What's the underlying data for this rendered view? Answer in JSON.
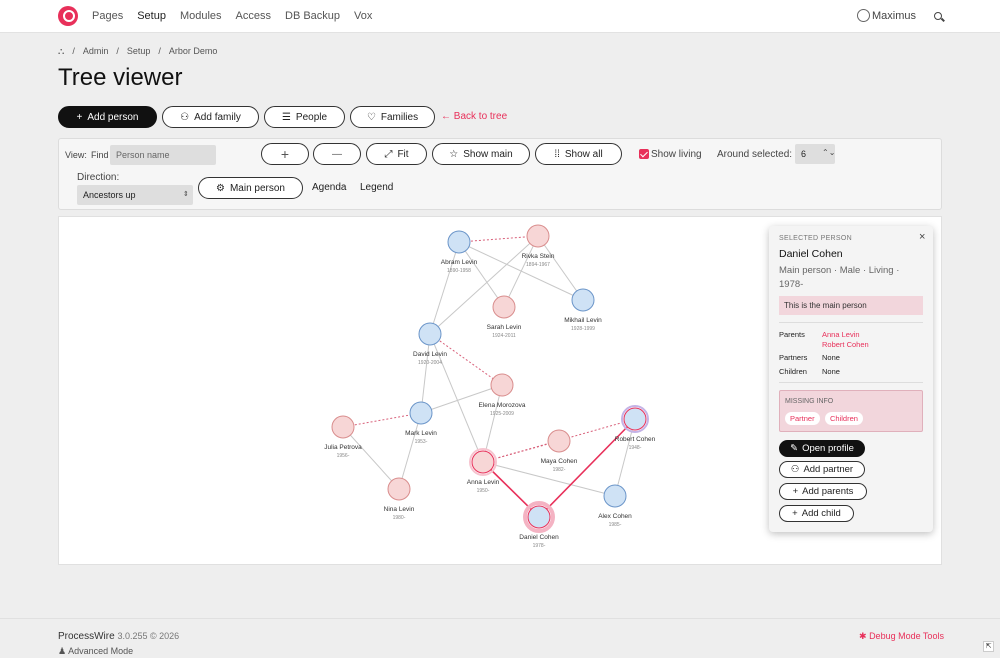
{
  "nav": {
    "items": [
      "Pages",
      "Setup",
      "Modules",
      "Access",
      "DB Backup",
      "Vox"
    ],
    "user": "Maximus"
  },
  "breadcrumb": [
    "Admin",
    "Setup",
    "Arbor Demo"
  ],
  "page": {
    "title": "Tree viewer"
  },
  "actions": {
    "add_person": "Add person",
    "add_family": "Add family",
    "people": "People",
    "families": "Families",
    "back": "← Back to tree"
  },
  "toolbar": {
    "view_label": "View:",
    "find_label": "Find",
    "find_placeholder": "Person name",
    "zoom_in": "+",
    "zoom_out": "—",
    "fit": "Fit",
    "show_main": "Show main",
    "show_all": "Show all",
    "show_living": "Show living",
    "around_label": "Around selected:",
    "around_value": "6",
    "direction_label": "Direction:",
    "direction_value": "Ancestors up",
    "main_person": "Main person",
    "agenda": "Agenda",
    "legend": "Legend"
  },
  "colors": {
    "accent": "#e8305a",
    "male": "#cfe2f5",
    "female": "#f7d6d6",
    "male_stroke": "#6b95c9",
    "female_stroke": "#d98d8d"
  },
  "tree": {
    "people": [
      {
        "id": "abram",
        "name": "Abram Levin",
        "dates": "1890-1958",
        "sex": "m"
      },
      {
        "id": "rivka",
        "name": "Rivka Stein",
        "dates": "1894-1967",
        "sex": "f"
      },
      {
        "id": "sarah",
        "name": "Sarah Levin",
        "dates": "1924-2011",
        "sex": "f"
      },
      {
        "id": "mikhail",
        "name": "Mikhail Levin",
        "dates": "1928-1999",
        "sex": "m"
      },
      {
        "id": "david",
        "name": "David Levin",
        "dates": "1920-2004",
        "sex": "m"
      },
      {
        "id": "elena",
        "name": "Elena Morozova",
        "dates": "1925-2009",
        "sex": "f"
      },
      {
        "id": "julia",
        "name": "Julia Petrova",
        "dates": "1956-",
        "sex": "f"
      },
      {
        "id": "mark",
        "name": "Mark Levin",
        "dates": "1953-",
        "sex": "m"
      },
      {
        "id": "robert",
        "name": "Robert Cohen",
        "dates": "1948-",
        "sex": "m"
      },
      {
        "id": "maya",
        "name": "Maya Cohen",
        "dates": "1982-",
        "sex": "f"
      },
      {
        "id": "anna",
        "name": "Anna Levin",
        "dates": "1950-",
        "sex": "f"
      },
      {
        "id": "nina",
        "name": "Nina Levin",
        "dates": "1980-",
        "sex": "f"
      },
      {
        "id": "alex",
        "name": "Alex Cohen",
        "dates": "1985-",
        "sex": "m"
      },
      {
        "id": "daniel",
        "name": "Daniel Cohen",
        "dates": "1978-",
        "sex": "m"
      }
    ]
  },
  "selected": {
    "heading": "SELECTED PERSON",
    "name": "Daniel Cohen",
    "meta": "Main person · Male · Living · 1978-",
    "note": "This is the main person",
    "parents_label": "Parents",
    "parent1": "Anna Levin",
    "parent2": "Robert Cohen",
    "partners_label": "Partners",
    "partners": "None",
    "children_label": "Children",
    "children": "None",
    "missing_label": "MISSING INFO",
    "missing1": "Partner",
    "missing2": "Children",
    "open_profile": "Open profile",
    "add_partner": "Add partner",
    "add_parents": "Add parents",
    "add_child": "Add child"
  },
  "footer": {
    "brand": "ProcessWire",
    "version": "3.0.255 © 2026",
    "mode": "Advanced Mode",
    "debug": "Debug Mode Tools"
  }
}
